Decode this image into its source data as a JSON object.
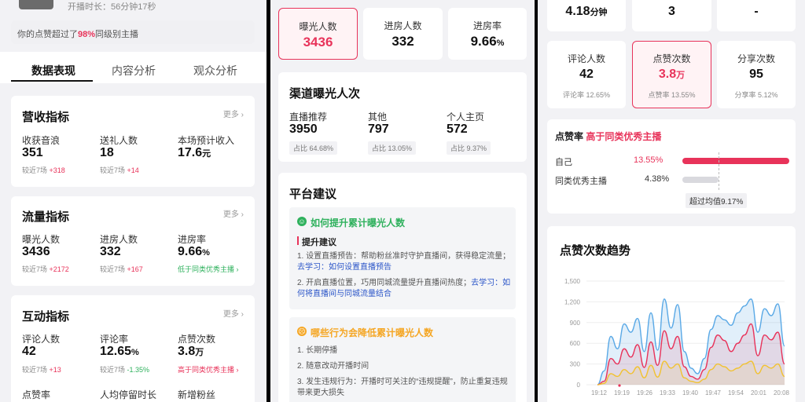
{
  "p1": {
    "header": {
      "duration_label": "开播时长：56分钟17秒"
    },
    "praise_banner": {
      "prefix": "你的点赞超过了",
      "pct": "98%",
      "suffix": "同级别主播"
    },
    "tabs": [
      {
        "label": "数据表现"
      },
      {
        "label": "内容分析"
      },
      {
        "label": "观众分析"
      }
    ],
    "more_label": "更多",
    "revenue": {
      "title": "营收指标",
      "m1": {
        "label": "收获音浪",
        "value": "351",
        "cmp": "较近7场",
        "delta": "+318"
      },
      "m2": {
        "label": "送礼人数",
        "value": "18",
        "cmp": "较近7场",
        "delta": "+14"
      },
      "m3": {
        "label": "本场预计收入",
        "value": "17.6",
        "unit": "元"
      }
    },
    "traffic": {
      "title": "流量指标",
      "m1": {
        "label": "曝光人数",
        "value": "3436",
        "cmp": "较近7场",
        "delta": "+2172"
      },
      "m2": {
        "label": "进房人数",
        "value": "332",
        "cmp": "较近7场",
        "delta": "+167"
      },
      "m3": {
        "label": "进房率",
        "value": "9.66",
        "unit": "%",
        "note": "低于同类优秀主播"
      }
    },
    "interact": {
      "title": "互动指标",
      "m1": {
        "label": "评论人数",
        "value": "42",
        "cmp": "较近7场",
        "delta": "+13"
      },
      "m2": {
        "label": "评论率",
        "value": "12.65",
        "unit": "%",
        "cmp": "较近7场",
        "delta": "-1.35%"
      },
      "m3": {
        "label": "点赞次数",
        "value": "3.8",
        "unit": "万",
        "note": "高于同类优秀主播"
      },
      "r2": [
        "点赞率",
        "人均停留时长",
        "新增粉丝"
      ]
    }
  },
  "p2": {
    "top": [
      {
        "label": "曝光人数",
        "value": "3436"
      },
      {
        "label": "进房人数",
        "value": "332"
      },
      {
        "label": "进房率",
        "value": "9.66",
        "unit": "%"
      }
    ],
    "channel": {
      "title": "渠道曝光人次",
      "items": [
        {
          "label": "直播推荐",
          "value": "3950",
          "share": "占比  64.68%"
        },
        {
          "label": "其他",
          "value": "797",
          "share": "占比  13.05%"
        },
        {
          "label": "个人主页",
          "value": "572",
          "share": "占比  9.37%"
        }
      ]
    },
    "advice": {
      "title": "平台建议",
      "box1": {
        "title": "如何提升累计曝光人数",
        "section": "提升建议",
        "item1_text": "1. 设置直播预告：帮助粉丝准时守护直播间，获得稳定流量；",
        "item1_link": "去学习：如何设置直播预告",
        "item2_text": "2. 开启直播位置，巧用同城流量提升直播间热度；",
        "item2_link": "去学习：如何将直播间与同城流量结合"
      },
      "box2": {
        "title": "哪些行为会降低累计曝光人数",
        "item1": "1. 长期停播",
        "item2": "2. 随意改动开播时间",
        "item3": "3. 发生违规行为：开播时可关注的“违规提醒”，防止重复违规带来更大损失"
      }
    }
  },
  "p3": {
    "top": [
      {
        "value": "4.18",
        "unit": "分钟"
      },
      {
        "value": "3"
      },
      {
        "value": "-"
      }
    ],
    "row": [
      {
        "label": "评论人数",
        "value": "42",
        "note": "评论率 12.65%"
      },
      {
        "label": "点赞次数",
        "value": "3.8",
        "unit": "万",
        "note": "点赞率 13.55%"
      },
      {
        "label": "分享次数",
        "value": "95",
        "note": "分享率 5.12%"
      }
    ],
    "rate": {
      "title": "点赞率",
      "tag": "高于同类优秀主播",
      "self_label": "自己",
      "self_value": "13.55%",
      "peer_label": "同类优秀主播",
      "peer_value": "4.38%",
      "avg_note": "超过均值9.17%"
    },
    "trend": {
      "title": "点赞次数趋势"
    }
  },
  "chart_data": {
    "type": "line",
    "title": "点赞次数趋势",
    "x": [
      "19:12",
      "19:19",
      "19:26",
      "19:33",
      "19:40",
      "19:47",
      "19:54",
      "20:01",
      "20:08"
    ],
    "ylim": [
      0,
      1500
    ],
    "yticks": [
      0,
      300,
      600,
      900,
      1200,
      1500
    ],
    "grid": true,
    "series": [
      {
        "color": "#5aa9e6",
        "values": [
          0,
          200,
          700,
          520,
          880,
          760,
          960,
          480,
          1040,
          500,
          1240,
          820,
          1160,
          480,
          240,
          160,
          380,
          800,
          1000,
          940,
          860,
          1040,
          1140,
          1240,
          760,
          1100,
          1000,
          1170,
          560
        ]
      },
      {
        "color": "#e8335a",
        "values": [
          0,
          50,
          380,
          300,
          520,
          400,
          580,
          250,
          620,
          280,
          780,
          520,
          700,
          260,
          120,
          80,
          220,
          540,
          720,
          640,
          480,
          600,
          720,
          880,
          420,
          720,
          650,
          760,
          300
        ]
      },
      {
        "color": "#f1c232",
        "values": [
          0,
          20,
          160,
          120,
          220,
          160,
          260,
          100,
          280,
          110,
          340,
          240,
          300,
          100,
          50,
          30,
          80,
          220,
          300,
          260,
          200,
          240,
          300,
          340,
          160,
          280,
          240,
          300,
          120
        ]
      }
    ]
  }
}
